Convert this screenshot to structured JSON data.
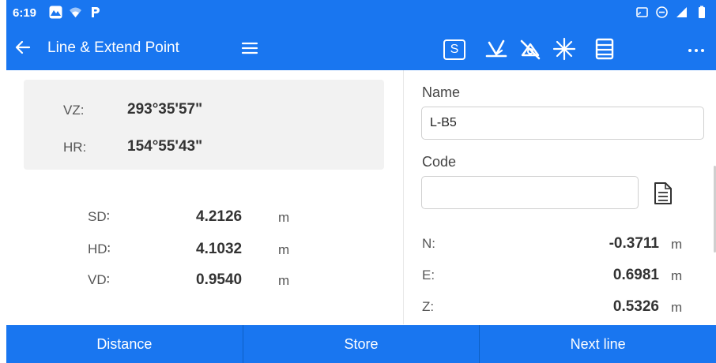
{
  "status_bar": {
    "time": "6:19",
    "left_icons": [
      "mountain-icon",
      "wifi-icon",
      "parking-icon"
    ],
    "right_icons": [
      "cast-icon",
      "do-not-disturb-icon",
      "signal-icon",
      "battery-icon"
    ]
  },
  "toolbar": {
    "title": "Line & Extend Point",
    "s_label": "S",
    "icons": [
      "laser-icon",
      "no-prism-icon",
      "star-icon",
      "list-icon",
      "more-icon"
    ]
  },
  "angles": {
    "vz_label": "VZ:",
    "vz_value": "293°35'57\"",
    "hr_label": "HR:",
    "hr_value": "154°55'43\""
  },
  "distances": {
    "sd_label": "SD∶",
    "sd_value": "4.2126",
    "sd_unit": "m",
    "hd_label": "HD∶",
    "hd_value": "4.1032",
    "hd_unit": "m",
    "vd_label": "VD∶",
    "vd_value": "0.9540",
    "vd_unit": "m"
  },
  "form": {
    "name_label": "Name",
    "name_value": "L-B5",
    "code_label": "Code",
    "code_value": ""
  },
  "coords": {
    "n_label": "N:",
    "n_value": "-0.3711",
    "n_unit": "m",
    "e_label": "E:",
    "e_value": "0.6981",
    "e_unit": "m",
    "z_label": "Z:",
    "z_value": "0.5326",
    "z_unit": "m"
  },
  "bottom_bar": {
    "distance_label": "Distance",
    "store_label": "Store",
    "next_line_label": "Next line"
  },
  "colors": {
    "accent": "#1976f0",
    "panel": "#f2f2f2"
  }
}
